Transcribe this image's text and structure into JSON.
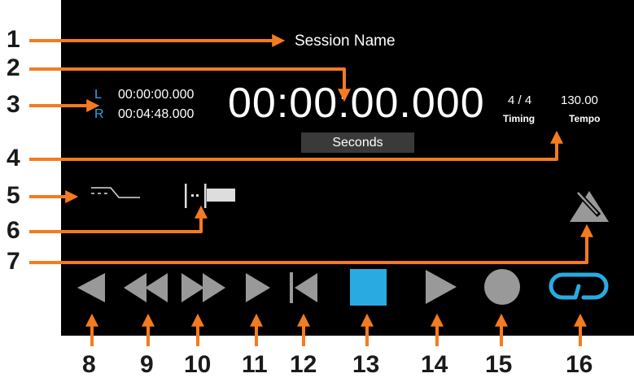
{
  "session_name": "Session Name",
  "locators": {
    "left_label": "L",
    "left_time": "00:00:00.000",
    "right_label": "R",
    "right_time": "00:04:48.000"
  },
  "main_time": "00:00:00.000",
  "time_format": "Seconds",
  "timing": {
    "value": "4 / 4",
    "label": "Timing"
  },
  "tempo": {
    "value": "130.00",
    "label": "Tempo"
  },
  "callouts": [
    "1",
    "2",
    "3",
    "4",
    "5",
    "6",
    "7",
    "8",
    "9",
    "10",
    "11",
    "12",
    "13",
    "14",
    "15",
    "16"
  ],
  "colors": {
    "accent_blue": "#29abe2",
    "callout_orange": "#f47b20",
    "button_gray": "#999999",
    "screen": "#000000",
    "stop_blue": "#29abe2"
  },
  "icons": {
    "fade": "fade-curve-icon",
    "marker": "marker-flag-icon",
    "metronome": "metronome-icon",
    "back": "rewind-to-start-icon",
    "rewind": "rewind-icon",
    "ffwd": "fast-forward-icon",
    "step_fwd": "step-forward-icon",
    "go_start": "go-to-start-icon",
    "stop": "stop-icon",
    "play": "play-icon",
    "record": "record-icon",
    "loop": "loop-icon"
  }
}
